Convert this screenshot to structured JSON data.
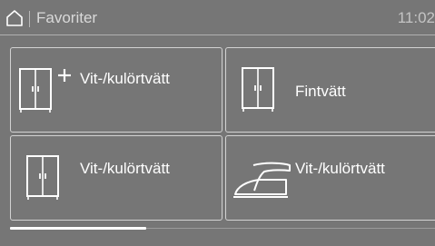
{
  "header": {
    "title": "Favoriter",
    "time": "11:02",
    "home_icon": "home-icon"
  },
  "tiles": [
    {
      "label": "Vit-/kulörtvätt",
      "icon": "wardrobe-plus-icon"
    },
    {
      "label": "Fintvätt",
      "icon": "wardrobe-icon"
    },
    {
      "label": "Vit-/kulörtvätt",
      "icon": "wardrobe-icon"
    },
    {
      "label": "Vit-/kulörtvätt",
      "icon": "iron-icon"
    }
  ],
  "scroll": {
    "position": 0.32
  },
  "colors": {
    "background": "#767676",
    "text": "#ffffff",
    "border": "#d2d2d2"
  }
}
